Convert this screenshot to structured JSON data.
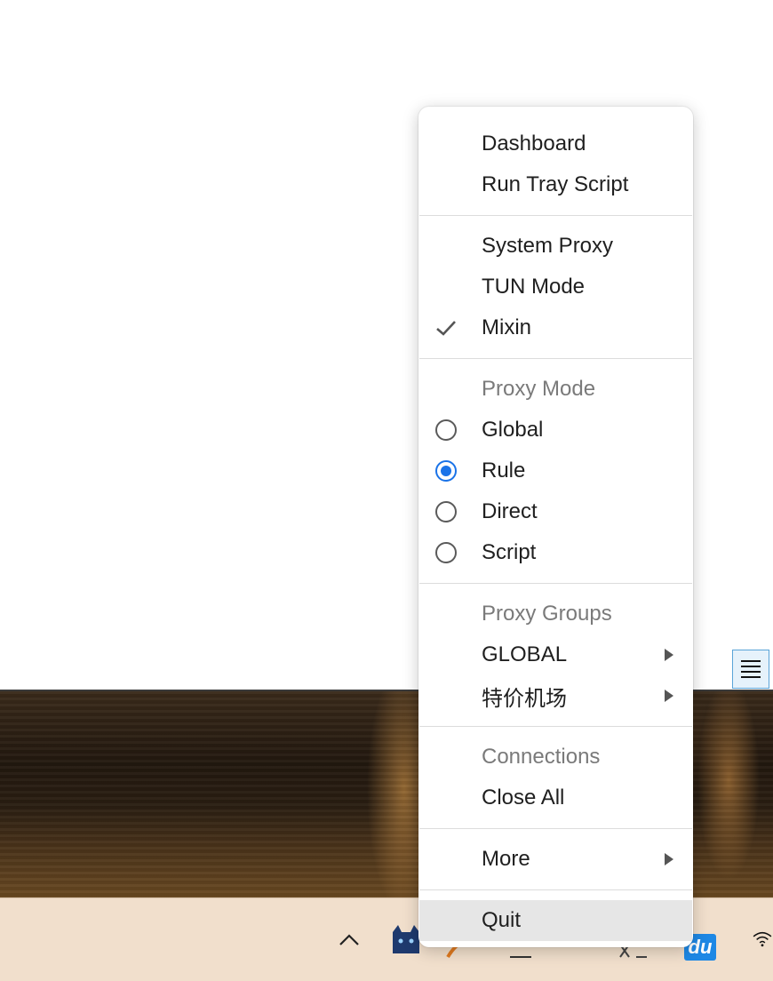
{
  "menu": {
    "dashboard": "Dashboard",
    "run_tray_script": "Run Tray Script",
    "system_proxy": "System Proxy",
    "tun_mode": "TUN Mode",
    "mixin": "Mixin",
    "mixin_checked": true,
    "proxy_mode_header": "Proxy Mode",
    "modes": [
      {
        "label": "Global",
        "selected": false
      },
      {
        "label": "Rule",
        "selected": true
      },
      {
        "label": "Direct",
        "selected": false
      },
      {
        "label": "Script",
        "selected": false
      }
    ],
    "proxy_groups_header": "Proxy Groups",
    "groups": [
      "GLOBAL",
      "特价机场"
    ],
    "connections_header": "Connections",
    "close_all": "Close All",
    "more": "More",
    "quit": "Quit"
  },
  "taskbar": {
    "baidu_label": "du"
  },
  "colors": {
    "accent": "#1a73e8",
    "hover": "#e6e6e6",
    "header_text": "#7a7a7a",
    "taskbar": "#f1dfcc"
  }
}
